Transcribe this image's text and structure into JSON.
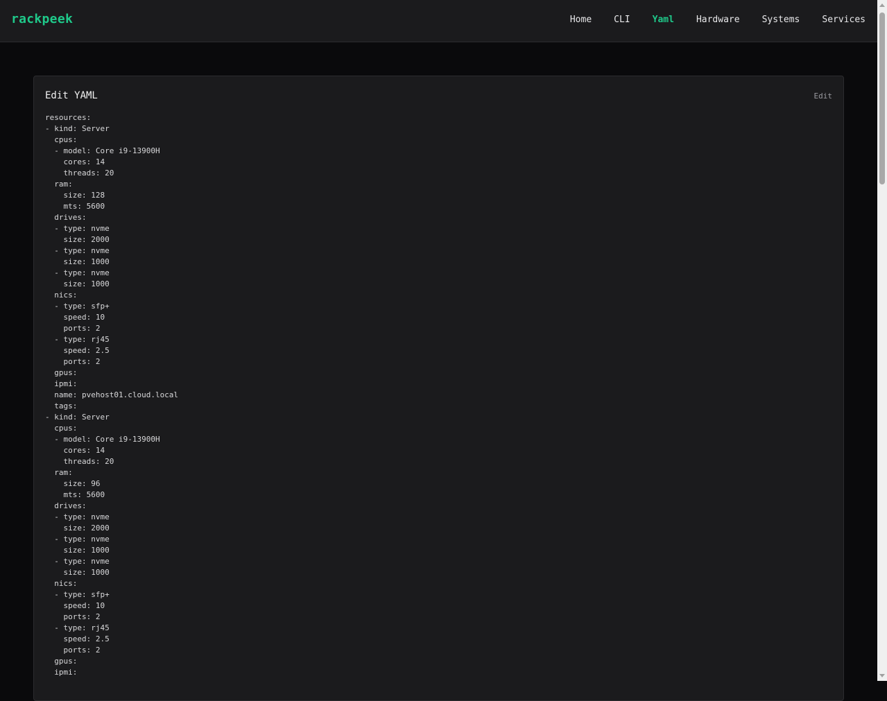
{
  "brand": "rackpeek",
  "nav": [
    {
      "label": "Home"
    },
    {
      "label": "CLI"
    },
    {
      "label": "Yaml",
      "active": true
    },
    {
      "label": "Hardware"
    },
    {
      "label": "Systems"
    },
    {
      "label": "Services"
    }
  ],
  "card": {
    "title": "Edit YAML",
    "edit_label": "Edit",
    "yaml_text": "resources:\n- kind: Server\n  cpus:\n  - model: Core i9-13900H\n    cores: 14\n    threads: 20\n  ram:\n    size: 128\n    mts: 5600\n  drives:\n  - type: nvme\n    size: 2000\n  - type: nvme\n    size: 1000\n  - type: nvme\n    size: 1000\n  nics:\n  - type: sfp+\n    speed: 10\n    ports: 2\n  - type: rj45\n    speed: 2.5\n    ports: 2\n  gpus:\n  ipmi:\n  name: pvehost01.cloud.local\n  tags:\n- kind: Server\n  cpus:\n  - model: Core i9-13900H\n    cores: 14\n    threads: 20\n  ram:\n    size: 96\n    mts: 5600\n  drives:\n  - type: nvme\n    size: 2000\n  - type: nvme\n    size: 1000\n  - type: nvme\n    size: 1000\n  nics:\n  - type: sfp+\n    speed: 10\n    ports: 2\n  - type: rj45\n    speed: 2.5\n    ports: 2\n  gpus:\n  ipmi:"
  }
}
